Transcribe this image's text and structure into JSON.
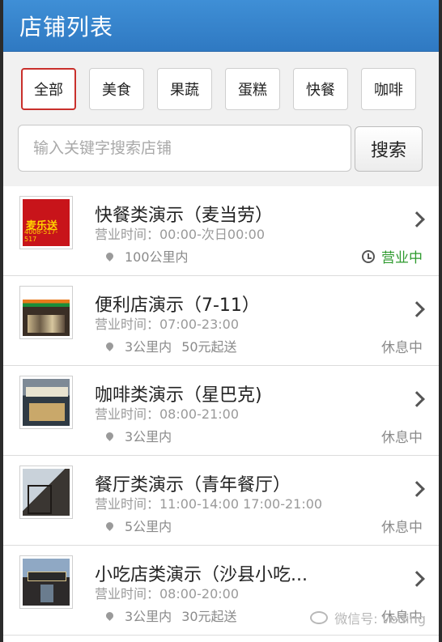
{
  "header": {
    "title": "店铺列表"
  },
  "tabs": [
    {
      "label": "全部",
      "active": true
    },
    {
      "label": "美食"
    },
    {
      "label": "果蔬"
    },
    {
      "label": "蛋糕"
    },
    {
      "label": "快餐"
    },
    {
      "label": "咖啡"
    }
  ],
  "search": {
    "placeholder": "输入关键字搜索店铺",
    "button": "搜索"
  },
  "stores": [
    {
      "name": "快餐类演示（麦当劳）",
      "hours": "营业时间：00:00-次日00:00",
      "distance": "100公里内",
      "min_order": "",
      "status": "营业中",
      "image": "mcdonalds-storefront"
    },
    {
      "name": "便利店演示（7-11）",
      "hours": "营业时间：07:00-23:00",
      "distance": "3公里内",
      "min_order": "50元起送",
      "status": "休息中",
      "image": "7-eleven-store"
    },
    {
      "name": "咖啡类演示（星巴克)",
      "hours": "营业时间：08:00-21:00",
      "distance": "3公里内",
      "min_order": "",
      "status": "休息中",
      "image": "starbucks-storefront"
    },
    {
      "name": "餐厅类演示（青年餐厅）",
      "hours": "营业时间：11:00-14:00 17:00-21:00",
      "distance": "5公里内",
      "min_order": "",
      "status": "休息中",
      "image": "restaurant-building"
    },
    {
      "name": "小吃店类演示（沙县小吃...",
      "hours": "营业时间：08:00-20:00",
      "distance": "3公里内",
      "min_order": "30元起送",
      "status": "休息中",
      "image": "snack-shop"
    }
  ],
  "image_text": {
    "mcdonalds_label": "麦乐送",
    "mcdonalds_phone": "4008-517-517"
  },
  "watermark": "微信号: veding",
  "colors": {
    "header": "#3384cc",
    "open_status": "#2e9a2e",
    "active_tab_border": "#c9302c"
  }
}
